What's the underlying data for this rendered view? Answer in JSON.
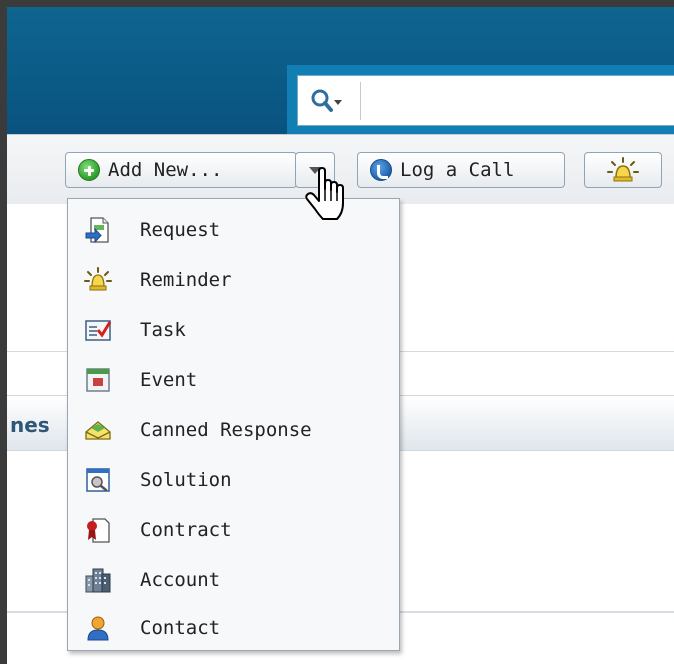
{
  "search": {
    "value": "",
    "placeholder": ""
  },
  "toolbar": {
    "add_new_label": "Add New...",
    "log_call_label": "Log a Call"
  },
  "background": {
    "section_text": "nes"
  },
  "menu": {
    "items": [
      {
        "label": "Request",
        "icon": "request-icon"
      },
      {
        "label": "Reminder",
        "icon": "reminder-icon"
      },
      {
        "label": "Task",
        "icon": "task-icon"
      },
      {
        "label": "Event",
        "icon": "event-icon"
      },
      {
        "label": "Canned Response",
        "icon": "canned-response-icon"
      },
      {
        "label": "Solution",
        "icon": "solution-icon"
      },
      {
        "label": "Contract",
        "icon": "contract-icon"
      },
      {
        "label": "Account",
        "icon": "account-icon"
      },
      {
        "label": "Contact",
        "icon": "contact-icon"
      }
    ]
  },
  "colors": {
    "header": "#0b5a86",
    "search_strip": "#117fb3",
    "menu_background": "#f7f8fa",
    "section_text": "#2f5577"
  }
}
